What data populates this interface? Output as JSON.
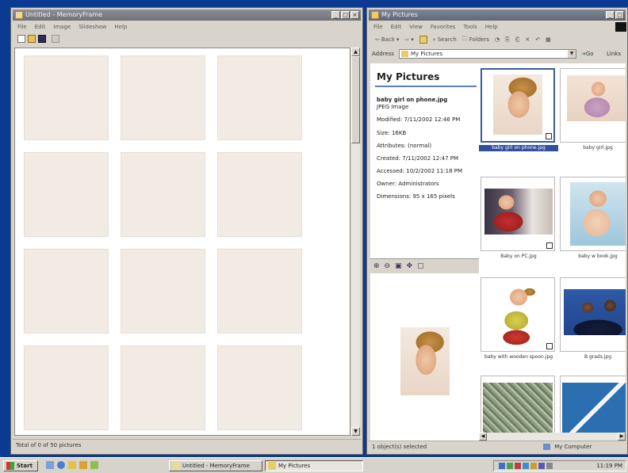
{
  "taskbar": {
    "start_label": "Start",
    "tasks": [
      {
        "label": "Untitled - MemoryFrame"
      },
      {
        "label": "My Pictures"
      }
    ],
    "clock": "11:19 PM"
  },
  "left_window": {
    "title": "Untitled - MemoryFrame",
    "menu": [
      "File",
      "Edit",
      "Image",
      "Slideshow",
      "Help"
    ],
    "status": "Total of 0 of 50 pictures"
  },
  "right_window": {
    "title": "My Pictures",
    "menu": [
      "File",
      "Edit",
      "View",
      "Favorites",
      "Tools",
      "Help"
    ],
    "toolbar": {
      "back": "Back",
      "search": "Search",
      "folders": "Folders"
    },
    "address_label": "Address",
    "address_value": "My Pictures",
    "go_label": "Go",
    "links_label": "Links",
    "panel": {
      "heading": "My Pictures",
      "file_name": "baby girl on phone.jpg",
      "file_type": "JPEG Image",
      "modified": "Modified: 7/11/2002 12:46 PM",
      "size": "Size: 16KB",
      "attributes": "Attributes: (normal)",
      "created": "Created: 7/11/2002 12:47 PM",
      "accessed": "Accessed: 10/2/2002 11:18 PM",
      "owner": "Owner: Administrators",
      "dimensions": "Dimensions: 95 x 165 pixels"
    },
    "thumbnails": [
      {
        "label": "baby girl on phone.jpg"
      },
      {
        "label": "baby girl.jpg"
      },
      {
        "label": "Baby on PC.jpg"
      },
      {
        "label": "baby w book.jpg"
      },
      {
        "label": "baby with wooden spoon.jpg"
      },
      {
        "label": "B grads.jpg"
      },
      {
        "label": ""
      },
      {
        "label": ""
      }
    ],
    "status_left": "1 object(s) selected",
    "status_right": "My Computer"
  }
}
